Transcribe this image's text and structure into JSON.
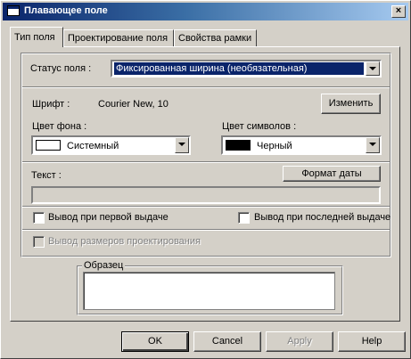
{
  "window": {
    "title": "Плавающее поле",
    "close_label": "×"
  },
  "tabs": [
    {
      "label": "Тип поля",
      "active": true
    },
    {
      "label": "Проектирование поля",
      "active": false
    },
    {
      "label": "Свойства рамки",
      "active": false
    }
  ],
  "status": {
    "label": "Статус поля :",
    "value": "Фиксированная ширина (необязательная)"
  },
  "font": {
    "label": "Шрифт :",
    "value": "Courier New, 10",
    "change_button": "Изменить"
  },
  "bg_color": {
    "label": "Цвет фона :",
    "value": "Системный",
    "swatch": "#ffffff"
  },
  "fg_color": {
    "label": "Цвет символов :",
    "value": "Черный",
    "swatch": "#000000"
  },
  "text": {
    "label": "Текст :",
    "value": "",
    "date_format_button": "Формат даты"
  },
  "checkboxes": {
    "first_output": {
      "label": "Вывод при первой выдаче",
      "checked": false
    },
    "last_output": {
      "label": "Вывод при последней выдаче",
      "checked": false
    },
    "design_sizes": {
      "label": "Вывод размеров проектирования",
      "checked": false,
      "disabled": true
    }
  },
  "sample": {
    "label": "Образец",
    "value": ""
  },
  "buttons": {
    "ok": "OK",
    "cancel": "Cancel",
    "apply": "Apply",
    "help": "Help"
  }
}
